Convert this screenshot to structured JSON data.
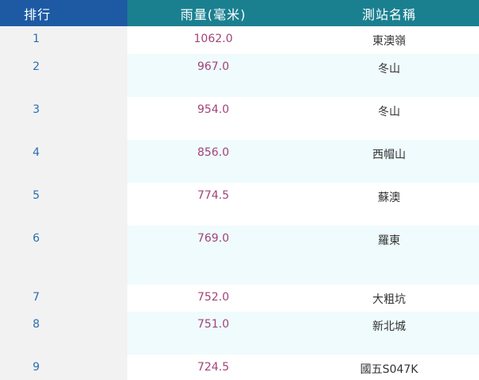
{
  "table": {
    "headers": {
      "rank": "排行",
      "rain": "雨量(毫米)",
      "station": "測站名稱"
    },
    "rows": [
      {
        "rank": "1",
        "rain": "1062.0",
        "station": "東澳嶺"
      },
      {
        "rank": "2",
        "rain": "967.0",
        "station": "冬山"
      },
      {
        "rank": "3",
        "rain": "954.0",
        "station": "冬山"
      },
      {
        "rank": "4",
        "rain": "856.0",
        "station": "西帽山"
      },
      {
        "rank": "5",
        "rain": "774.5",
        "station": "蘇澳"
      },
      {
        "rank": "6",
        "rain": "769.0",
        "station": "羅東"
      },
      {
        "rank": "7",
        "rain": "752.0",
        "station": "大粗坑"
      },
      {
        "rank": "8",
        "rain": "751.0",
        "station": "新北城"
      },
      {
        "rank": "9",
        "rain": "724.5",
        "station": "國五S047K"
      }
    ]
  },
  "colors": {
    "rank_header_bg": "#1d5aa3",
    "header_bg": "#1a8090",
    "rank_text": "#2a6fb0",
    "rain_text": "#a3437a",
    "row_alt_bg": "#effbfc",
    "rank_col_bg": "#f2f2f2"
  }
}
